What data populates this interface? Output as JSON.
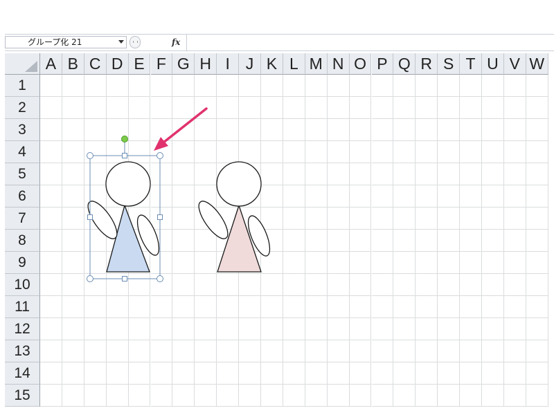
{
  "formula_bar": {
    "name_box_value": "グループ化 21",
    "fx_label": "fx",
    "formula_value": ""
  },
  "columns": [
    "A",
    "B",
    "C",
    "D",
    "E",
    "F",
    "G",
    "H",
    "I",
    "J",
    "K",
    "L",
    "M",
    "N",
    "O",
    "P",
    "Q",
    "R",
    "S",
    "T",
    "U",
    "V",
    "W"
  ],
  "rows": [
    "1",
    "2",
    "3",
    "4",
    "5",
    "6",
    "7",
    "8",
    "9",
    "10",
    "11",
    "12",
    "13",
    "14",
    "15"
  ],
  "shapes": {
    "selected_group": {
      "body_fill": "#c9daf1",
      "label": "グループ化 21"
    },
    "second_figure": {
      "body_fill": "#f0dada"
    },
    "selection_color": "#6b8db5",
    "rotation_handle_color": "#7ccb4a",
    "arrow_color": "#e0336d"
  },
  "colors": {
    "header_bg": "#e9ecf0",
    "gridline": "#dadcdd"
  }
}
